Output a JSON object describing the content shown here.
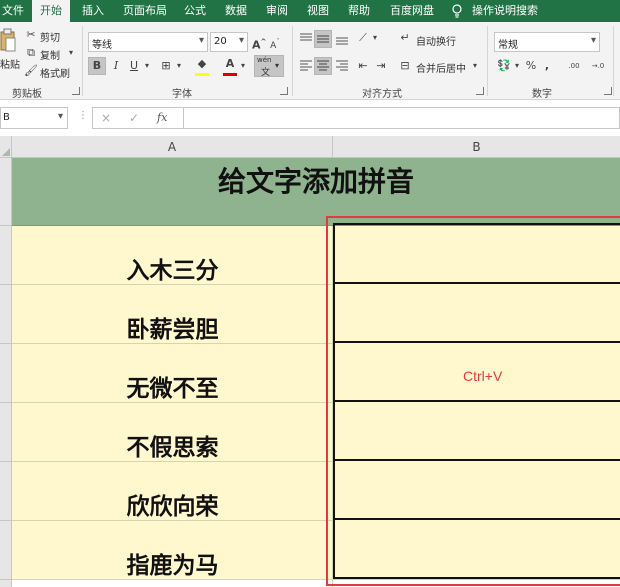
{
  "tabs": [
    "文件",
    "开始",
    "插入",
    "页面布局",
    "公式",
    "数据",
    "审阅",
    "视图",
    "帮助",
    "百度网盘",
    "操作说明搜索"
  ],
  "ribbon": {
    "clipboard": {
      "paste": "粘贴",
      "cut": "剪切",
      "copy": "复制",
      "format_painter": "格式刷",
      "label": "剪贴板"
    },
    "font": {
      "font_name": "等线",
      "font_size": "20",
      "grow": "A",
      "shrink": "A",
      "bold": "B",
      "italic": "I",
      "underline": "U",
      "font_color_glyph": "A",
      "pinyin_glyph": "wén",
      "label": "字体"
    },
    "alignment": {
      "wrap_text": "自动换行",
      "merge_center": "合并后居中",
      "label": "对齐方式"
    },
    "number": {
      "format": "常规",
      "percent": "%",
      "comma": ",",
      "increase_decimal": ".00",
      "decrease_decimal": "→.0",
      "label": "数字"
    }
  },
  "formula_bar": {
    "name_box": "B",
    "fx": "fx",
    "cancel": "×",
    "enter": "✓",
    "value": ""
  },
  "sheet": {
    "col_headers": [
      "A",
      "B"
    ],
    "title": "给文字添加拼音",
    "idioms": [
      "入木三分",
      "卧薪尝胆",
      "无微不至",
      "不假思索",
      "欣欣向荣",
      "指鹿为马"
    ],
    "annotation": "Ctrl+V"
  },
  "colors": {
    "ribbon_green": "#217346",
    "header_fill": "#8fb28f",
    "cell_fill": "#fff8cf",
    "highlight_red": "#e33b3b"
  }
}
